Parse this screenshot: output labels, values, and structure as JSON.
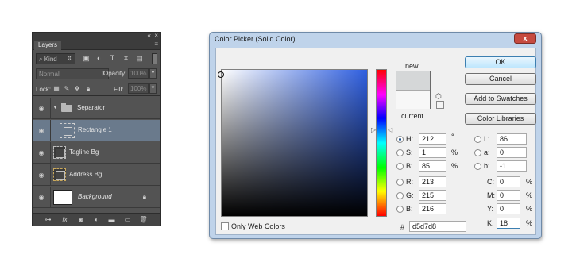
{
  "layers_panel": {
    "tab_label": "Layers",
    "collapse_glyph": "«",
    "close_glyph": "×",
    "menu_glyph": "≡",
    "filter": {
      "kind_label": "Kind",
      "icons": [
        "image-filter-icon",
        "adjustment-filter-icon",
        "type-filter-icon",
        "shape-filter-icon",
        "smart-object-filter-icon"
      ]
    },
    "blend_mode": "Normal",
    "opacity_label": "Opacity:",
    "opacity_value": "100%",
    "lock_label": "Lock:",
    "fill_label": "Fill:",
    "fill_value": "100%",
    "layers": [
      {
        "name": "Separator",
        "type": "group",
        "expanded": true
      },
      {
        "name": "Rectangle 1",
        "type": "shape",
        "selected": true
      },
      {
        "name": "Tagline Bg",
        "type": "shape"
      },
      {
        "name": "Address Bg",
        "type": "shape"
      },
      {
        "name": "Background",
        "type": "background",
        "locked": true
      }
    ],
    "footer_icons": [
      "link-layers-icon",
      "fx-icon",
      "add-mask-icon",
      "adjustment-layer-icon",
      "new-group-icon",
      "new-layer-icon",
      "delete-layer-icon"
    ]
  },
  "color_picker": {
    "title": "Color Picker (Solid Color)",
    "close_glyph": "x",
    "new_label": "new",
    "current_label": "current",
    "new_color": "#d5d7d8",
    "current_color": "#f7f7f7",
    "buttons": {
      "ok": "OK",
      "cancel": "Cancel",
      "add_to_swatches": "Add to Swatches",
      "color_libraries": "Color Libraries"
    },
    "hsb": {
      "h_label": "H:",
      "h_value": "212",
      "h_unit": "°",
      "s_label": "S:",
      "s_value": "1",
      "s_unit": "%",
      "b_label": "B:",
      "b_value": "85",
      "b_unit": "%"
    },
    "rgb": {
      "r_label": "R:",
      "r_value": "213",
      "g_label": "G:",
      "g_value": "215",
      "b_label": "B:",
      "b_value": "216"
    },
    "lab": {
      "l_label": "L:",
      "l_value": "86",
      "a_label": "a:",
      "a_value": "0",
      "b_label": "b:",
      "b_value": "-1"
    },
    "cmyk": {
      "c_label": "C:",
      "c_value": "0",
      "m_label": "M:",
      "m_value": "0",
      "y_label": "Y:",
      "y_value": "0",
      "k_label": "K:",
      "k_value": "18",
      "unit": "%"
    },
    "hex_label": "#",
    "hex_value": "d5d7d8",
    "only_web_colors_label": "Only Web Colors",
    "selected_mode": "H"
  }
}
